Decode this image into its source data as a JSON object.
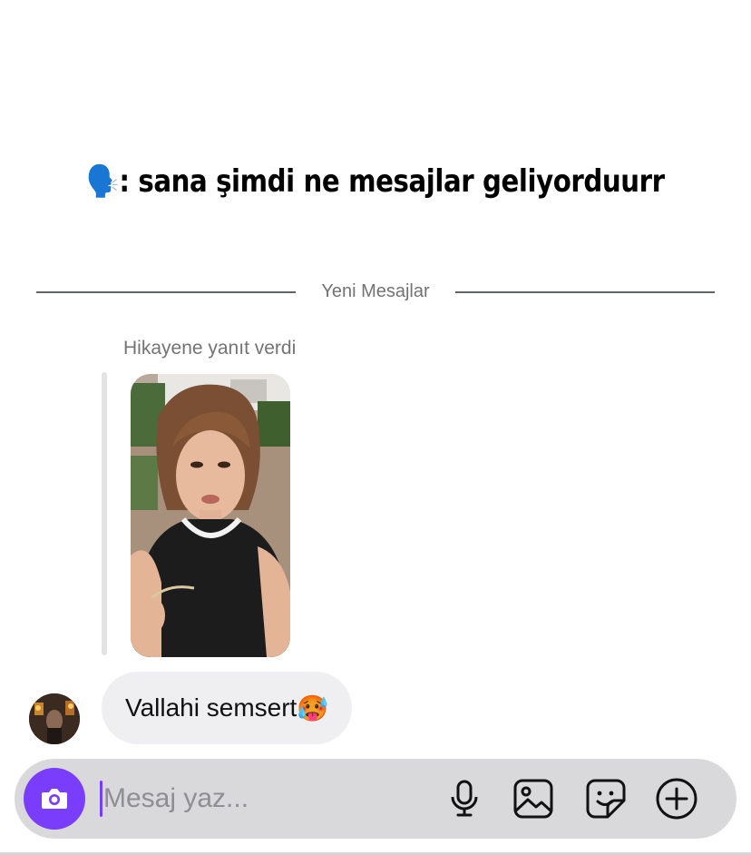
{
  "caption": {
    "emoji": "🗣️",
    "text": ": sana şimdi ne mesajlar geliyorduurr"
  },
  "divider": {
    "label": "Yeni Mesajlar"
  },
  "story_reply": {
    "meta": "Hikayene yanıt verdi"
  },
  "message": {
    "text": "Vallahi semsert",
    "emoji": "🥵"
  },
  "composer": {
    "placeholder": "Mesaj yaz...",
    "accent": "#7a3dfb",
    "icons": [
      "camera-icon",
      "microphone-icon",
      "gallery-icon",
      "sticker-icon",
      "plus-icon"
    ]
  }
}
